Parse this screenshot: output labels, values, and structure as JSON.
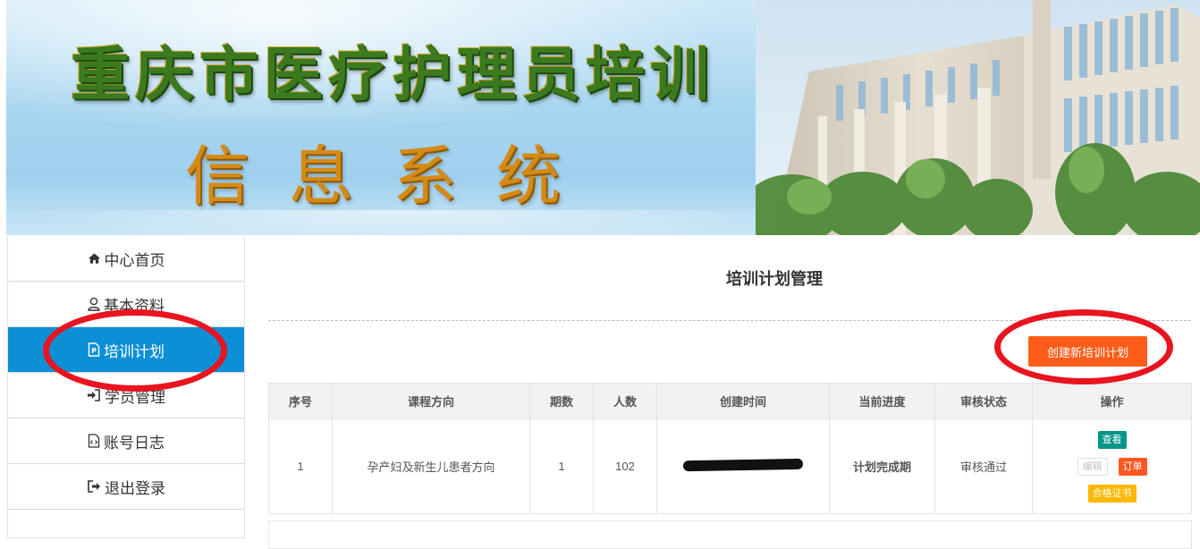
{
  "banner": {
    "title_line1": "重庆市医疗护理员培训",
    "title_line2": "信息系统"
  },
  "sidebar": {
    "items": [
      {
        "label": "中心首页",
        "icon": "home-icon"
      },
      {
        "label": "基本资料",
        "icon": "user-icon"
      },
      {
        "label": "培训计划",
        "icon": "document-icon",
        "active": true
      },
      {
        "label": "学员管理",
        "icon": "sign-in-icon"
      },
      {
        "label": "账号日志",
        "icon": "code-file-icon"
      },
      {
        "label": "退出登录",
        "icon": "sign-out-icon"
      }
    ]
  },
  "main": {
    "title": "培训计划管理",
    "create_button": "创建新培训计划",
    "table": {
      "headers": [
        "序号",
        "课程方向",
        "期数",
        "人数",
        "创建时间",
        "当前进度",
        "审核状态",
        "操作"
      ],
      "rows": [
        {
          "index": "1",
          "course": "孕产妇及新生儿患者方向",
          "period": "1",
          "count": "102",
          "created": "",
          "progress": "计划完成期",
          "audit": "审核通过",
          "actions": {
            "view": "查看",
            "edit": "编辑",
            "order": "订单",
            "cert": "合格证书"
          }
        }
      ]
    }
  },
  "colors": {
    "active_nav": "#0d8fd6",
    "create_button": "#fd5d19",
    "progress_text": "#d60000",
    "audit_text": "#118a2b",
    "annotation": "#e8141f"
  }
}
